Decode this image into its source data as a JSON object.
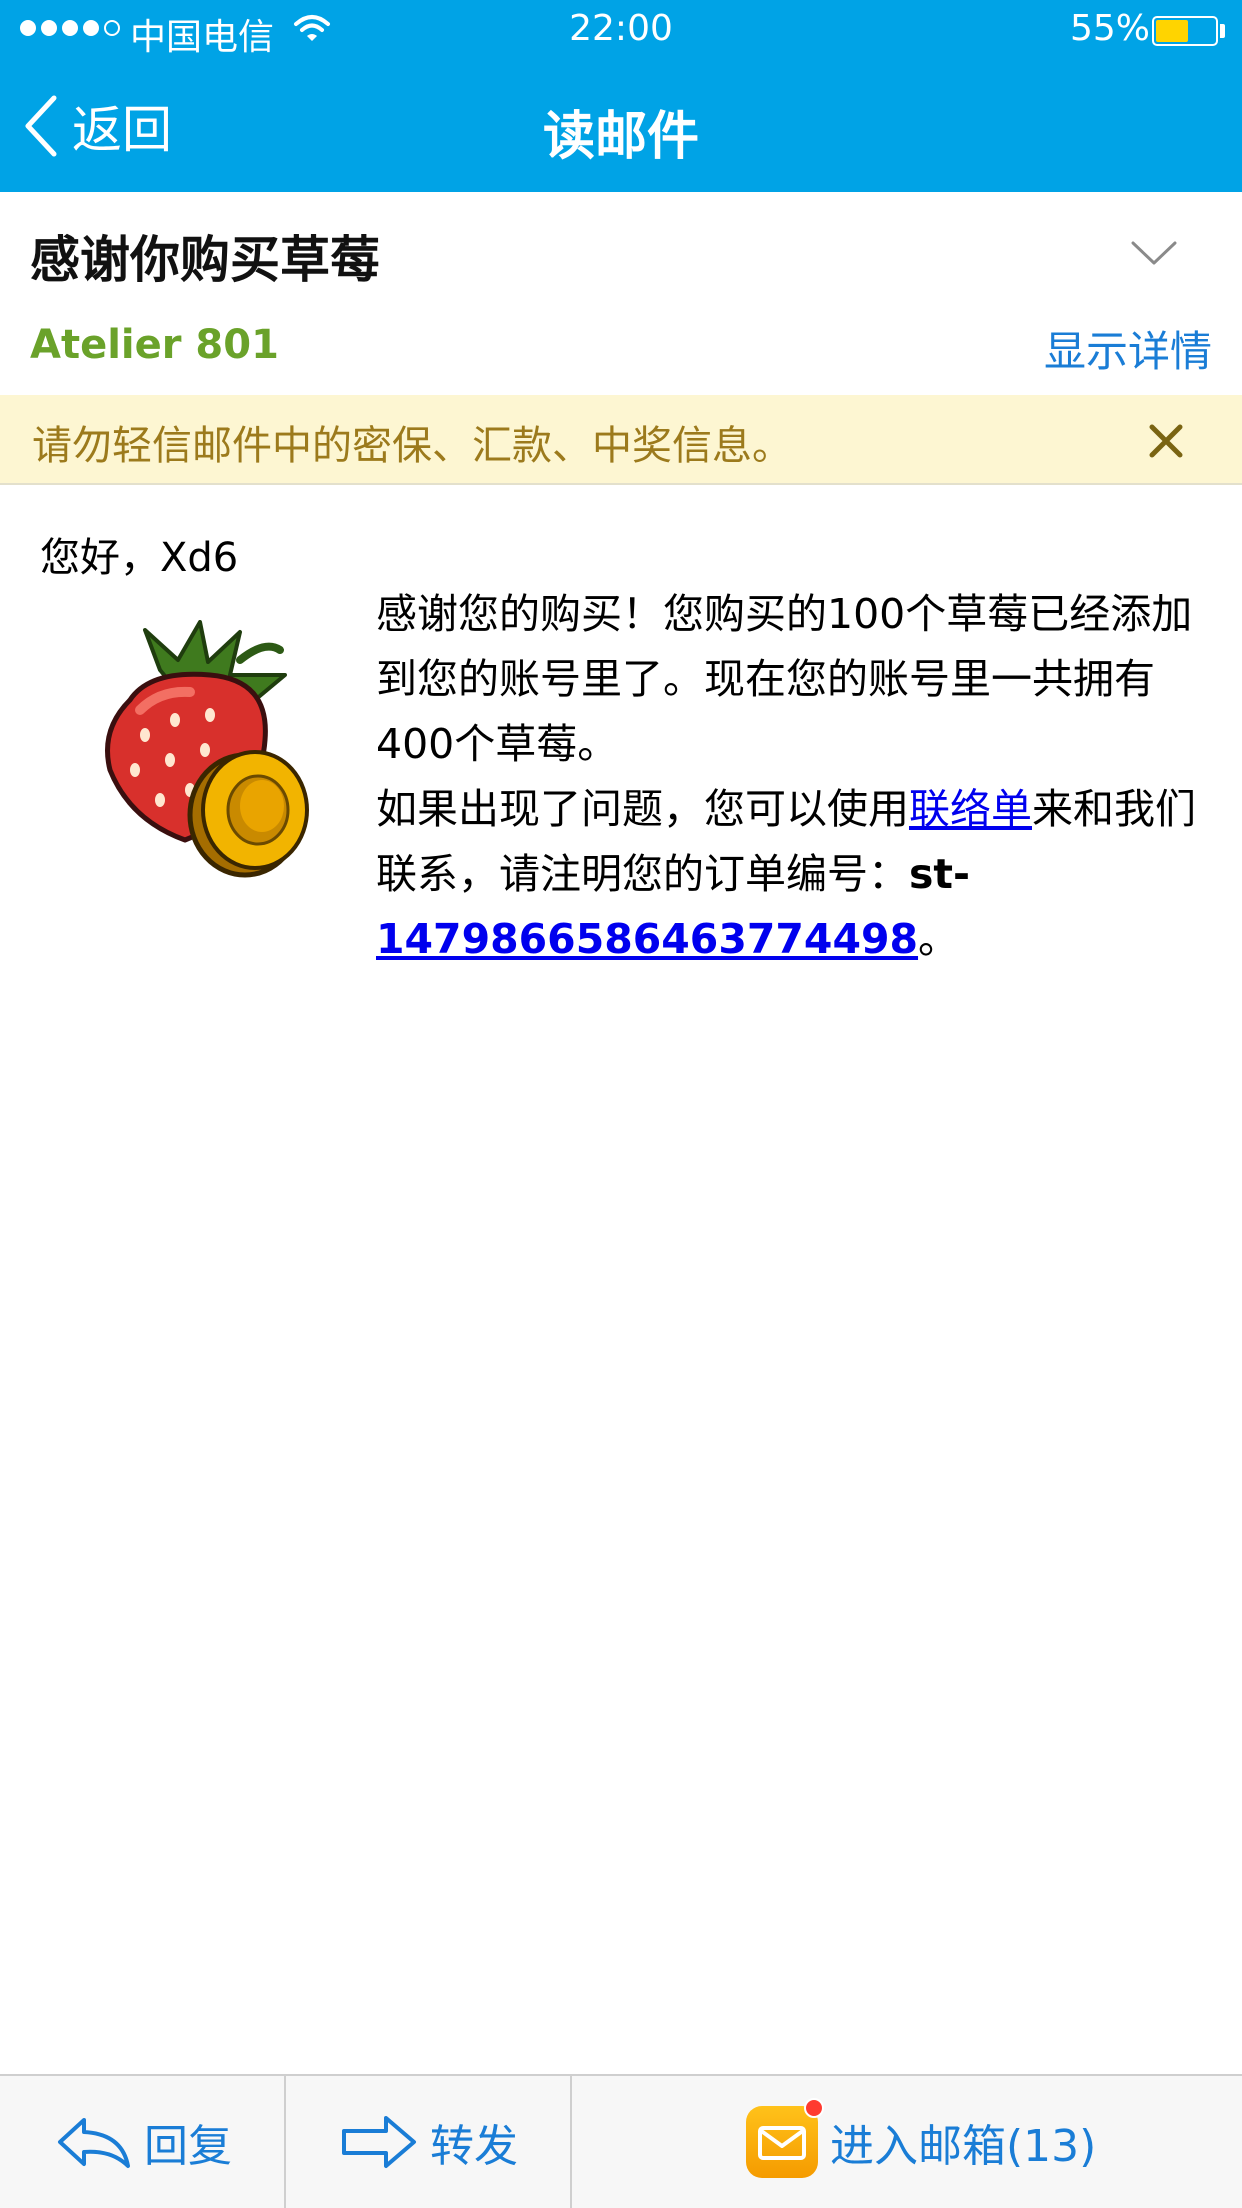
{
  "status_bar": {
    "carrier": "中国电信",
    "time": "22:00",
    "battery": "55%",
    "battery_level": 0.55
  },
  "nav": {
    "back_label": "返回",
    "title": "读邮件"
  },
  "mail": {
    "subject": "感谢你购买草莓",
    "sender": "Atelier 801",
    "details_label": "显示详情"
  },
  "warning": {
    "text": "请勿轻信邮件中的密保、汇款、中奖信息。"
  },
  "body": {
    "greeting": "您好，Xd6",
    "paragraph1": "感谢您的购买！您购买的100个草莓已经添加到您的账号里了。现在您的账号里一共拥有400个草莓。",
    "p2_before": "如果出现了问题，您可以使用",
    "p2_link": "联络单",
    "p2_after": "来和我们联系，请注明您的订单编号：",
    "order_prefix": "st-",
    "order_number": "1479866586463774498",
    "order_suffix": "。"
  },
  "toolbar": {
    "reply_label": "回复",
    "forward_label": "转发",
    "inbox_label": "进入邮箱(13)"
  }
}
